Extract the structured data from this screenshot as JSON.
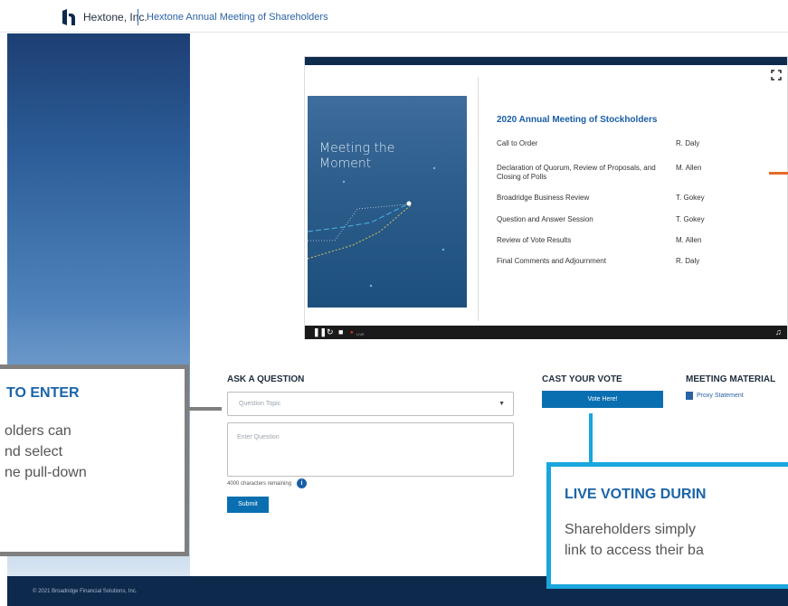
{
  "header": {
    "brand": "Hextone, Inc.",
    "meeting_title": "Hextone Annual Meeting of Shareholders"
  },
  "player": {
    "slide_image_title": "Meeting the Moment",
    "agenda_title": "2020 Annual Meeting of Stockholders",
    "agenda": [
      {
        "item": "Call to Order",
        "presenter": "R. Daly"
      },
      {
        "item": "Declaration of Quorum, Review of Proposals, and Closing of Polls",
        "presenter": "M. Allen"
      },
      {
        "item": "Broadridge Business Review",
        "presenter": "T. Gokey"
      },
      {
        "item": "Question and Answer Session",
        "presenter": "T. Gokey"
      },
      {
        "item": "Review of Vote Results",
        "presenter": "M. Allen"
      },
      {
        "item": "Final Comments and Adjournment",
        "presenter": "R. Daly"
      }
    ],
    "live_label": "LIVE"
  },
  "ask": {
    "heading": "ASK A QUESTION",
    "topic_placeholder": "Question Topic",
    "question_placeholder": "Enter Question",
    "chars_remaining": "4000 characters remaining",
    "submit_label": "Submit"
  },
  "vote": {
    "heading": "CAST YOUR VOTE",
    "button_label": "Vote Here!"
  },
  "materials": {
    "heading": "MEETING MATERIAL",
    "link": "Proxy Statement"
  },
  "footer": {
    "copyright": "© 2021 Broadridge Financial Solutions, Inc."
  },
  "callouts": {
    "left_title": "TO ENTER",
    "left_body_lines": [
      "olders can",
      "nd select",
      "ne pull-down"
    ],
    "right_title": "LIVE VOTING DURIN",
    "right_body_lines": [
      "Shareholders simply",
      "link to access their ba"
    ]
  },
  "colors": {
    "brand_blue": "#1a5ea6",
    "button_blue": "#0a6fb0",
    "footer_navy": "#0d2a4d",
    "callout_cyan": "#19a6dc",
    "callout_gray": "#7f7f7f",
    "accent_orange": "#e46b2a"
  }
}
